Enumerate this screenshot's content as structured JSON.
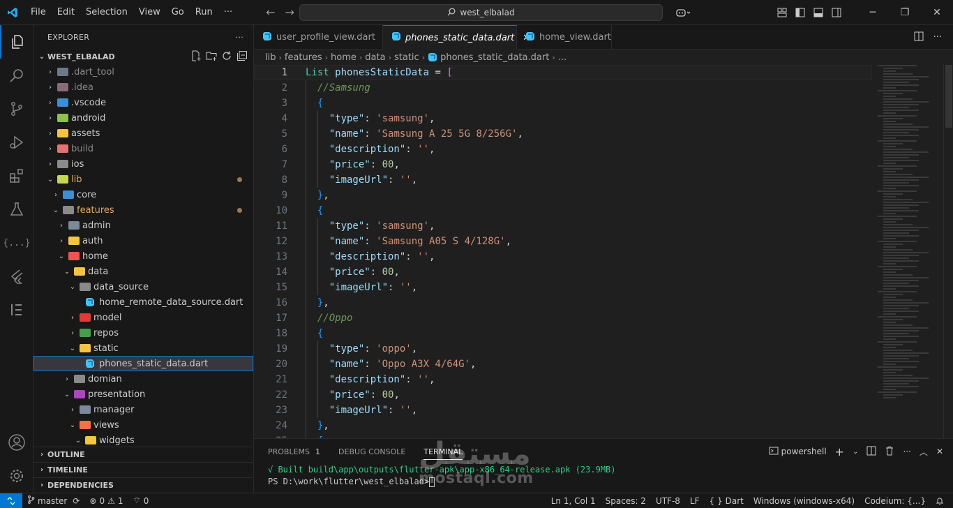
{
  "menu": [
    "File",
    "Edit",
    "Selection",
    "View",
    "Go",
    "Run",
    "···"
  ],
  "search": {
    "text": "west_elbalad"
  },
  "explorer": {
    "title": "EXPLORER",
    "more": "···",
    "workspace": "WEST_ELBALAD",
    "items": [
      {
        "label": ".dart_tool",
        "depth": 0,
        "folder": true,
        "open": false,
        "dim": true,
        "color": "#6a7a8a"
      },
      {
        "label": ".idea",
        "depth": 0,
        "folder": true,
        "open": false,
        "dim": true,
        "color": "#8a6a7a"
      },
      {
        "label": ".vscode",
        "depth": 0,
        "folder": true,
        "open": false,
        "color": "#3b8fd9"
      },
      {
        "label": "android",
        "depth": 0,
        "folder": true,
        "open": false,
        "color": "#8bc34a"
      },
      {
        "label": "assets",
        "depth": 0,
        "folder": true,
        "open": false,
        "color": "#f5c542"
      },
      {
        "label": "build",
        "depth": 0,
        "folder": true,
        "open": false,
        "dim": true,
        "color": "#e57373"
      },
      {
        "label": "ios",
        "depth": 0,
        "folder": true,
        "open": false,
        "color": "#8a8a8a"
      },
      {
        "label": "lib",
        "depth": 0,
        "folder": true,
        "open": true,
        "modified": true,
        "color": "#c6d84b"
      },
      {
        "label": "core",
        "depth": 1,
        "folder": true,
        "open": false,
        "color": "#3b8fd9"
      },
      {
        "label": "features",
        "depth": 1,
        "folder": true,
        "open": true,
        "modified": true,
        "color": "#8a8a8a"
      },
      {
        "label": "admin",
        "depth": 2,
        "folder": true,
        "open": false,
        "color": "#7a8a9a"
      },
      {
        "label": "auth",
        "depth": 2,
        "folder": true,
        "open": false,
        "color": "#f5c542"
      },
      {
        "label": "home",
        "depth": 2,
        "folder": true,
        "open": true,
        "color": "#ef5350"
      },
      {
        "label": "data",
        "depth": 3,
        "folder": true,
        "open": true,
        "color": "#f5c542"
      },
      {
        "label": "data_source",
        "depth": 4,
        "folder": true,
        "open": true,
        "color": "#8a8a8a"
      },
      {
        "label": "home_remote_data_source.dart",
        "depth": 5,
        "folder": false
      },
      {
        "label": "model",
        "depth": 4,
        "folder": true,
        "open": false,
        "color": "#e53935"
      },
      {
        "label": "repos",
        "depth": 4,
        "folder": true,
        "open": false,
        "color": "#43a047"
      },
      {
        "label": "static",
        "depth": 4,
        "folder": true,
        "open": true,
        "color": "#f5c542"
      },
      {
        "label": "phones_static_data.dart",
        "depth": 5,
        "folder": false,
        "selected": true
      },
      {
        "label": "domian",
        "depth": 3,
        "folder": true,
        "open": false,
        "color": "#8a8a8a"
      },
      {
        "label": "presentation",
        "depth": 3,
        "folder": true,
        "open": true,
        "color": "#ab47bc"
      },
      {
        "label": "manager",
        "depth": 4,
        "folder": true,
        "open": false,
        "color": "#7a8a9a"
      },
      {
        "label": "views",
        "depth": 4,
        "folder": true,
        "open": true,
        "color": "#ff7043"
      },
      {
        "label": "widgets",
        "depth": 5,
        "folder": true,
        "open": true,
        "color": "#f5c542"
      }
    ],
    "sections": [
      "OUTLINE",
      "TIMELINE",
      "DEPENDENCIES"
    ]
  },
  "tabs": [
    {
      "label": "user_profile_view.dart",
      "active": false
    },
    {
      "label": "phones_static_data.dart",
      "active": true
    },
    {
      "label": "home_view.dart",
      "active": false
    }
  ],
  "breadcrumb": [
    "lib",
    "features",
    "home",
    "data",
    "static",
    "phones_static_data.dart",
    "..."
  ],
  "code": [
    {
      "n": "1",
      "t": [
        [
          "kw",
          "List"
        ],
        [
          "op",
          " "
        ],
        [
          "var",
          "phonesStaticData"
        ],
        [
          "op",
          " = "
        ],
        [
          "br",
          "["
        ]
      ]
    },
    {
      "n": "2",
      "t": [
        [
          "op",
          "  "
        ],
        [
          "cmt",
          "//Samsung"
        ]
      ]
    },
    {
      "n": "3",
      "t": [
        [
          "op",
          "  "
        ],
        [
          "br2",
          "{"
        ]
      ]
    },
    {
      "n": "4",
      "t": [
        [
          "op",
          "    "
        ],
        [
          "var",
          "\"type\""
        ],
        [
          "op",
          ": "
        ],
        [
          "str",
          "'samsung'"
        ],
        [
          "op",
          ","
        ]
      ]
    },
    {
      "n": "5",
      "t": [
        [
          "op",
          "    "
        ],
        [
          "var",
          "\"name\""
        ],
        [
          "op",
          ": "
        ],
        [
          "str",
          "'Samsung A 25 5G 8/256G'"
        ],
        [
          "op",
          ","
        ]
      ]
    },
    {
      "n": "6",
      "t": [
        [
          "op",
          "    "
        ],
        [
          "var",
          "\"description\""
        ],
        [
          "op",
          ": "
        ],
        [
          "str",
          "''"
        ],
        [
          "op",
          ","
        ]
      ]
    },
    {
      "n": "7",
      "t": [
        [
          "op",
          "    "
        ],
        [
          "var",
          "\"price\""
        ],
        [
          "op",
          ": "
        ],
        [
          "num",
          "00"
        ],
        [
          "op",
          ","
        ]
      ]
    },
    {
      "n": "8",
      "t": [
        [
          "op",
          "    "
        ],
        [
          "var",
          "\"imageUrl\""
        ],
        [
          "op",
          ": "
        ],
        [
          "str",
          "''"
        ],
        [
          "op",
          ","
        ]
      ]
    },
    {
      "n": "9",
      "t": [
        [
          "op",
          "  "
        ],
        [
          "br2",
          "}"
        ],
        [
          "op",
          ","
        ]
      ]
    },
    {
      "n": "10",
      "t": [
        [
          "op",
          "  "
        ],
        [
          "br2",
          "{"
        ]
      ]
    },
    {
      "n": "11",
      "t": [
        [
          "op",
          "    "
        ],
        [
          "var",
          "\"type\""
        ],
        [
          "op",
          ": "
        ],
        [
          "str",
          "'samsung'"
        ],
        [
          "op",
          ","
        ]
      ]
    },
    {
      "n": "12",
      "t": [
        [
          "op",
          "    "
        ],
        [
          "var",
          "\"name\""
        ],
        [
          "op",
          ": "
        ],
        [
          "str",
          "'Samsung A05 S 4/128G'"
        ],
        [
          "op",
          ","
        ]
      ]
    },
    {
      "n": "13",
      "t": [
        [
          "op",
          "    "
        ],
        [
          "var",
          "\"description\""
        ],
        [
          "op",
          ": "
        ],
        [
          "str",
          "''"
        ],
        [
          "op",
          ","
        ]
      ]
    },
    {
      "n": "14",
      "t": [
        [
          "op",
          "    "
        ],
        [
          "var",
          "\"price\""
        ],
        [
          "op",
          ": "
        ],
        [
          "num",
          "00"
        ],
        [
          "op",
          ","
        ]
      ]
    },
    {
      "n": "15",
      "t": [
        [
          "op",
          "    "
        ],
        [
          "var",
          "\"imageUrl\""
        ],
        [
          "op",
          ": "
        ],
        [
          "str",
          "''"
        ],
        [
          "op",
          ","
        ]
      ]
    },
    {
      "n": "16",
      "t": [
        [
          "op",
          "  "
        ],
        [
          "br2",
          "}"
        ],
        [
          "op",
          ","
        ]
      ]
    },
    {
      "n": "17",
      "t": [
        [
          "op",
          "  "
        ],
        [
          "cmt",
          "//Oppo"
        ]
      ]
    },
    {
      "n": "18",
      "t": [
        [
          "op",
          "  "
        ],
        [
          "br2",
          "{"
        ]
      ]
    },
    {
      "n": "19",
      "t": [
        [
          "op",
          "    "
        ],
        [
          "var",
          "\"type\""
        ],
        [
          "op",
          ": "
        ],
        [
          "str",
          "'oppo'"
        ],
        [
          "op",
          ","
        ]
      ]
    },
    {
      "n": "20",
      "t": [
        [
          "op",
          "    "
        ],
        [
          "var",
          "\"name\""
        ],
        [
          "op",
          ": "
        ],
        [
          "str",
          "'Oppo A3X 4/64G'"
        ],
        [
          "op",
          ","
        ]
      ]
    },
    {
      "n": "21",
      "t": [
        [
          "op",
          "    "
        ],
        [
          "var",
          "\"description\""
        ],
        [
          "op",
          ": "
        ],
        [
          "str",
          "''"
        ],
        [
          "op",
          ","
        ]
      ]
    },
    {
      "n": "22",
      "t": [
        [
          "op",
          "    "
        ],
        [
          "var",
          "\"price\""
        ],
        [
          "op",
          ": "
        ],
        [
          "num",
          "00"
        ],
        [
          "op",
          ","
        ]
      ]
    },
    {
      "n": "23",
      "t": [
        [
          "op",
          "    "
        ],
        [
          "var",
          "\"imageUrl\""
        ],
        [
          "op",
          ": "
        ],
        [
          "str",
          "''"
        ],
        [
          "op",
          ","
        ]
      ]
    },
    {
      "n": "24",
      "t": [
        [
          "op",
          "  "
        ],
        [
          "br2",
          "}"
        ],
        [
          "op",
          ","
        ]
      ]
    },
    {
      "n": "25",
      "t": [
        [
          "op",
          "  "
        ],
        [
          "br2",
          "{"
        ]
      ]
    }
  ],
  "panel": {
    "tabs": [
      {
        "label": "PROBLEMS",
        "badge": "1",
        "active": false
      },
      {
        "label": "DEBUG CONSOLE",
        "active": false
      },
      {
        "label": "TERMINAL",
        "active": true
      }
    ],
    "shell": "powershell",
    "terminal_line1": "√ Built build\\app\\outputs\\flutter-apk\\app-x86_64-release.apk (23.9MB)",
    "terminal_line2": "PS D:\\work\\flutter\\west_elbalad>"
  },
  "watermark": {
    "arabic": "مستقل",
    "latin": "mostaql.com"
  },
  "status": {
    "branch": "master",
    "errors": "0",
    "warnings": "1",
    "ports": "0",
    "position": "Ln 1, Col 1",
    "spaces": "Spaces: 2",
    "encoding": "UTF-8",
    "eol": "LF",
    "language": "Dart",
    "device": "Windows (windows-x64)",
    "codeium": "Codeium: {...}"
  },
  "colors": {
    "accent": "#0078d4",
    "dart_icon": "#40c4ff"
  }
}
